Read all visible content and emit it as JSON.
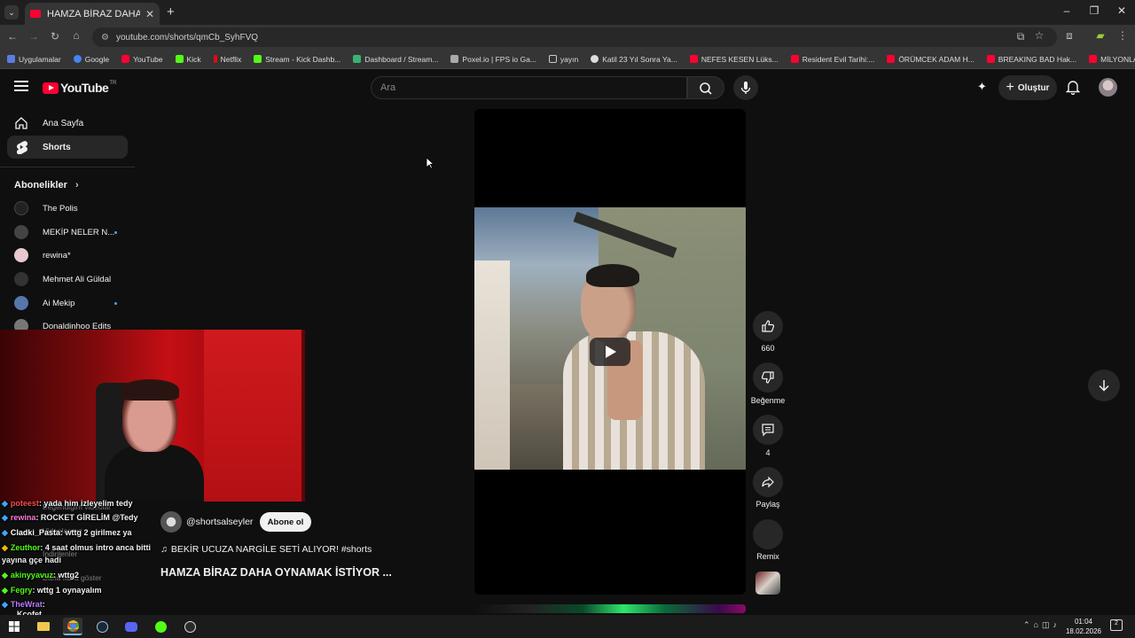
{
  "browser": {
    "tab_title": "HAMZA BİRAZ DAHA OYNAMAK İSTİYOR ...",
    "url": "youtube.com/shorts/qmCb_SyhFVQ",
    "bookmarks": [
      "Uygulamalar",
      "Google",
      "YouTube",
      "Kick",
      "Netflix",
      "Stream - Kick Dashb...",
      "Dashboard / Stream...",
      "Poxel.io | FPS io Ga...",
      "yayın",
      "Katil 23 Yıl Sonra Ya...",
      "NEFES KESEN Lüks...",
      "Resident Evil Tarihi:...",
      "ÖRÜMCEK ADAM H...",
      "BREAKING BAD Hak...",
      "MİLYONLAR ÇALAR..."
    ],
    "bookmark_colors": [
      "#5a7de0",
      "#4285f4",
      "#ff0033",
      "#53fc18",
      "#e50914",
      "#53fc18",
      "#3bb273",
      "#aaaaaa",
      "#888888",
      "#dddddd",
      "#ff0033",
      "#ff0033",
      "#ff0033",
      "#ff0033",
      "#ff0033"
    ]
  },
  "youtube": {
    "logo": "YouTube",
    "region": "TR",
    "search_placeholder": "Ara",
    "create_label": "Oluştur"
  },
  "sidebar": {
    "items": [
      {
        "label": "Ana Sayfa",
        "icon": "home-icon"
      },
      {
        "label": "Shorts",
        "icon": "shorts-icon"
      }
    ],
    "subs_heading": "Abonelikler",
    "subs": [
      {
        "name": "The Polis",
        "color": "#222222",
        "new": false
      },
      {
        "name": "MEKİP NELER N...",
        "color": "#444444",
        "new": true
      },
      {
        "name": "rewina*",
        "color": "#e9c9d0",
        "new": false
      },
      {
        "name": "Mehmet Ali Güldal",
        "color": "#333333",
        "new": false
      },
      {
        "name": "Ai Mekip",
        "color": "#5577aa",
        "new": true
      },
      {
        "name": "Donaldinhoo Edits",
        "color": "#777777",
        "new": false
      }
    ],
    "hidden_items": [
      "Beğendiğim videolar",
      "Videolarınız",
      "İndirilenler",
      "Daha fazla göster"
    ]
  },
  "chat": [
    {
      "user": "poteest",
      "color": "#ff4d4d",
      "msg": ": yada him izleyelim tedy"
    },
    {
      "user": "rewina",
      "color": "#ff7ad9",
      "msg": ": ROCKET GİRELİM @Tedy"
    },
    {
      "user": "Cladki_Pasta",
      "color": "#ffffff",
      "msg": ": wttg 2 girilmez ya"
    },
    {
      "user": "Zeuthor",
      "color": "#53fc18",
      "msg": ": 4 saat olmus intro anca bitti"
    },
    {
      "user": "",
      "color": "#ffffff",
      "msg": "yayına gçe hadi"
    },
    {
      "user": "akinyyavuz",
      "color": "#53fc18",
      "msg": ": wttg2"
    },
    {
      "user": "Fegry",
      "color": "#53fc18",
      "msg": ": wttg 1 oynayalım"
    },
    {
      "user": "TheWrat",
      "color": "#b77dff",
      "msg": ":"
    },
    {
      "user": "Kcofet",
      "color": "#ffffff",
      "msg": ""
    }
  ],
  "short": {
    "likes": "660",
    "dislike_label": "Beğenme",
    "comments": "4",
    "share_label": "Paylaş",
    "remix_label": "Remix",
    "channel": "@shortsalseyler",
    "subscribe_label": "Abone ol",
    "song": "BEKİR UCUZA NARGİLE SETİ ALIYOR! #shorts",
    "title": "HAMZA BİRAZ DAHA OYNAMAK İSTİYOR ..."
  },
  "taskbar": {
    "time": "01:04",
    "date": "18.02.2026",
    "notifications": "2"
  }
}
